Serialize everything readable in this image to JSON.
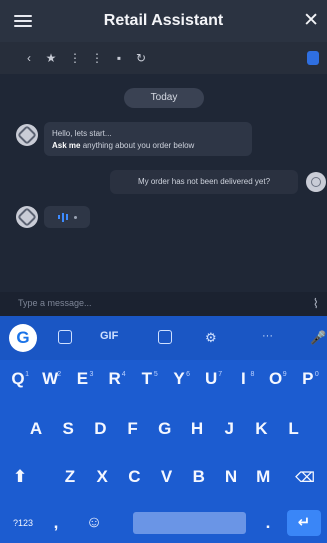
{
  "header": {
    "title": "Retail Assistant"
  },
  "chat": {
    "date_label": "Today",
    "bot_line1": "Hello, lets start...",
    "bot_line2_bold": "Ask me",
    "bot_line2_rest": " anything about you order below",
    "user_message": "My order has not been delivered yet?"
  },
  "composer": {
    "placeholder": "Type a message..."
  },
  "keyboard": {
    "suggestion_gif": "GIF",
    "suggestion_more": "···",
    "row1": [
      {
        "k": "Q",
        "n": "1"
      },
      {
        "k": "W",
        "n": "2"
      },
      {
        "k": "E",
        "n": "3"
      },
      {
        "k": "R",
        "n": "4"
      },
      {
        "k": "T",
        "n": "5"
      },
      {
        "k": "Y",
        "n": "6"
      },
      {
        "k": "U",
        "n": "7"
      },
      {
        "k": "I",
        "n": "8"
      },
      {
        "k": "O",
        "n": "9"
      },
      {
        "k": "P",
        "n": "0"
      }
    ],
    "row2": [
      "A",
      "S",
      "D",
      "F",
      "G",
      "H",
      "J",
      "K",
      "L"
    ],
    "row3": [
      "Z",
      "X",
      "C",
      "V",
      "B",
      "N",
      "M"
    ],
    "sym_label": "?123",
    "comma": ",",
    "period": "."
  },
  "colors": {
    "titlebar": "#2b3341",
    "chat_bg": "#1f2736",
    "keyboard": "#1c5cd0",
    "accent": "#3a86f7"
  }
}
